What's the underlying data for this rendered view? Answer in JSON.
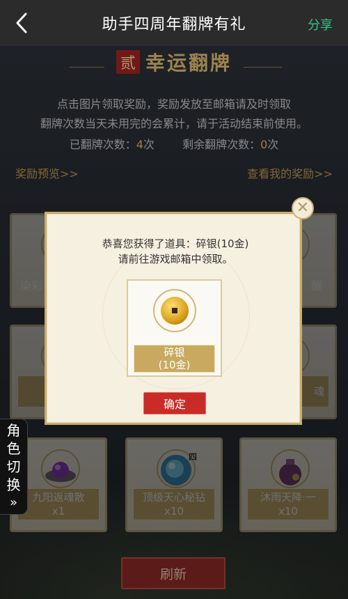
{
  "header": {
    "title": "助手四周年翻牌有礼",
    "share_label": "分享"
  },
  "banner": {
    "badge": "贰",
    "title": "幸运翻牌"
  },
  "description": {
    "line1": "点击图片领取奖励，奖励发放至邮箱请及时领取",
    "line2": "翻牌次数当天未用完的会累计，请于活动结束前使用。"
  },
  "counts": {
    "flipped_label": "已翻牌次数：",
    "flipped_value": "4",
    "flipped_unit": "次",
    "remaining_label": "剩余翻牌次数：",
    "remaining_value": "0",
    "remaining_unit": "次"
  },
  "links": {
    "preview": "奖励预览>>",
    "my_rewards": "查看我的奖励>>"
  },
  "cards_top_partial": {
    "left_text": "染彩",
    "right_text": "醒"
  },
  "cards_middle_partial": {
    "right_text": "魂"
  },
  "cards_bottom": [
    {
      "name": "九阳返魂散",
      "qty": "x1",
      "icon": "purple-orb-icon"
    },
    {
      "name": "顶级天心秘钻",
      "qty": "x10",
      "icon": "blue-gem-icon",
      "tag": "四"
    },
    {
      "name": "沐雨天降·一",
      "qty": "x10",
      "icon": "pouch-icon"
    }
  ],
  "role_switch": {
    "chars": [
      "角",
      "色",
      "切",
      "换"
    ],
    "arrow": "»"
  },
  "refresh_label": "刷新",
  "modal": {
    "line1": "恭喜您获得了道具：碎银(10金)",
    "line2": "请前往游戏邮箱中领取。",
    "reward_name": "碎银",
    "reward_qty": "(10金)",
    "confirm_label": "确定"
  },
  "colors": {
    "accent_gold": "#d8b66c",
    "share_green": "#35c48a",
    "button_red": "#c92b27"
  }
}
